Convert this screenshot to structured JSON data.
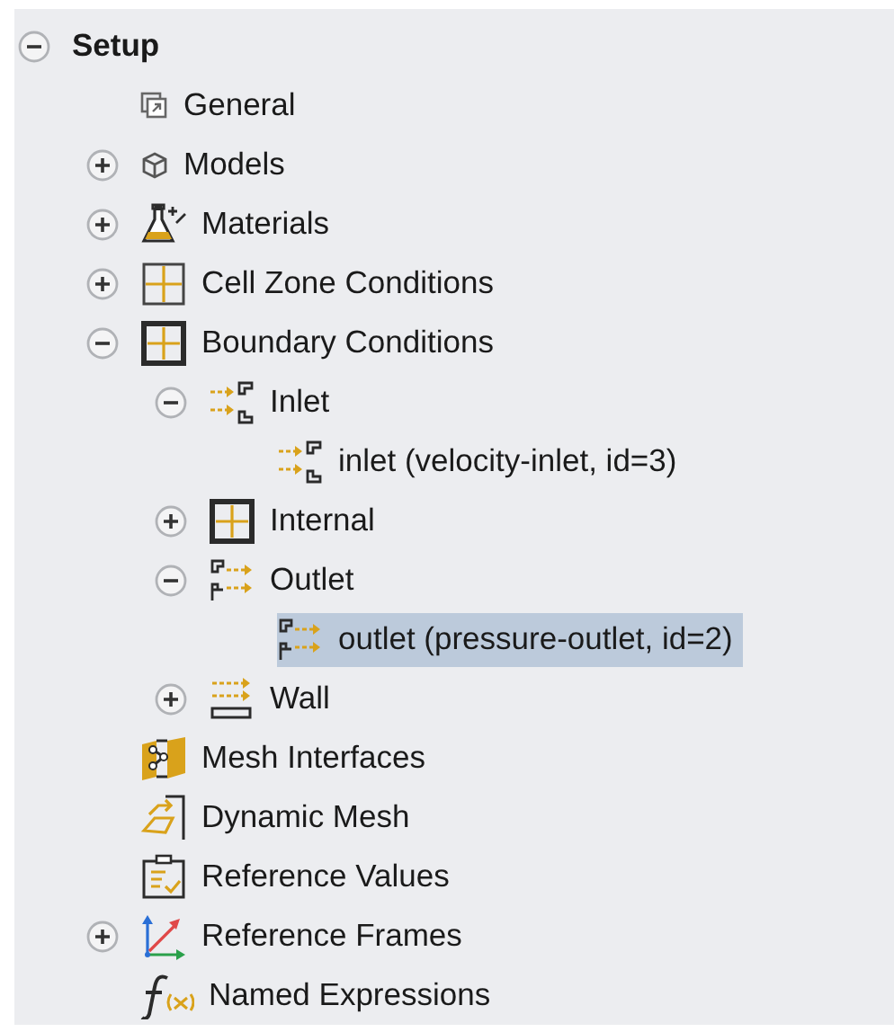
{
  "tree": [
    {
      "label": "Setup",
      "expanded": true,
      "selected": false,
      "children": [
        {
          "label": "General",
          "kind": "general",
          "selected": false
        },
        {
          "label": "Models",
          "kind": "models",
          "expanded": false,
          "selected": false
        },
        {
          "label": "Materials",
          "kind": "materials",
          "expanded": false,
          "selected": false
        },
        {
          "label": "Cell Zone Conditions",
          "kind": "cell-zone",
          "expanded": false,
          "selected": false
        },
        {
          "label": "Boundary Conditions",
          "kind": "boundary",
          "expanded": true,
          "selected": false,
          "children": [
            {
              "label": "Inlet",
              "kind": "inlet",
              "expanded": true,
              "selected": false,
              "children": [
                {
                  "label": "inlet (velocity-inlet, id=3)",
                  "kind": "inlet",
                  "selected": false
                }
              ]
            },
            {
              "label": "Internal",
              "kind": "boundary",
              "expanded": false,
              "selected": false
            },
            {
              "label": "Outlet",
              "kind": "outlet",
              "expanded": true,
              "selected": false,
              "children": [
                {
                  "label": "outlet (pressure-outlet, id=2)",
                  "kind": "outlet",
                  "selected": true
                }
              ]
            },
            {
              "label": "Wall",
              "kind": "wall",
              "expanded": false,
              "selected": false
            }
          ]
        },
        {
          "label": "Mesh Interfaces",
          "kind": "mesh-interfaces",
          "selected": false
        },
        {
          "label": "Dynamic Mesh",
          "kind": "dynamic-mesh",
          "selected": false
        },
        {
          "label": "Reference Values",
          "kind": "reference-values",
          "selected": false
        },
        {
          "label": "Reference Frames",
          "kind": "reference-frames",
          "expanded": false,
          "selected": false
        },
        {
          "label": "Named Expressions",
          "kind": "expressions",
          "selected": false
        }
      ]
    }
  ]
}
